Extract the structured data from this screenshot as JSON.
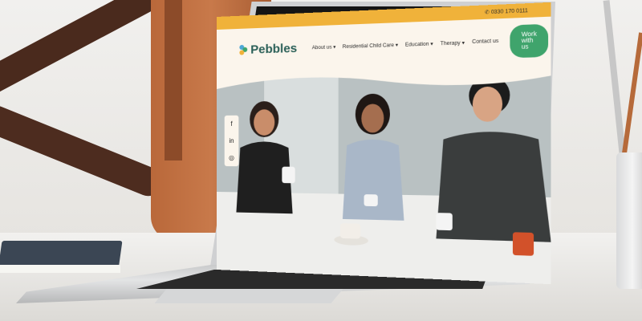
{
  "site": {
    "phone": "0330 170 0111",
    "logo_text": "Pebbles",
    "nav": [
      "About us",
      "Residential Child Care",
      "Education",
      "Therapy",
      "Contact us"
    ],
    "cta": "Work with us"
  },
  "social": {
    "facebook": "f",
    "linkedin": "in",
    "instagram": "◎"
  },
  "colors": {
    "topbar": "#f0b23a",
    "nav_bg": "#fbf5ec",
    "logo": "#2a5f57",
    "cta": "#3fa46c"
  },
  "icons": [
    "phone-icon",
    "facebook-icon",
    "linkedin-icon",
    "instagram-icon"
  ]
}
